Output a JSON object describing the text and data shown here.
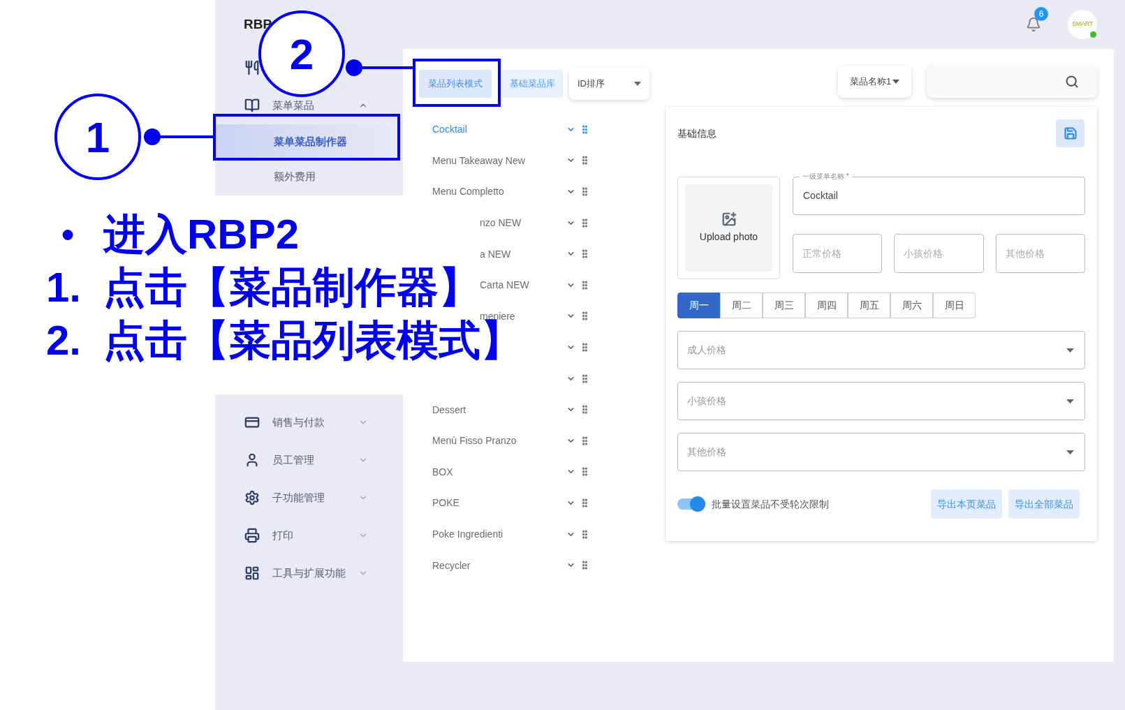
{
  "header": {
    "title": "RBP",
    "notification_count": "6",
    "avatar_logo": "SMART",
    "online": true
  },
  "sidebar": [
    {
      "kind": "icon_only"
    },
    {
      "kind": "group",
      "label": "菜单菜品",
      "expanded": true,
      "children": [
        {
          "label": "菜单菜品制作器",
          "selected": true
        },
        {
          "label": "额外费用",
          "selected": false
        }
      ]
    },
    {
      "kind": "group",
      "label": "销售与付款",
      "expanded": false
    },
    {
      "kind": "group",
      "label": "员工管理",
      "expanded": false
    },
    {
      "kind": "group",
      "label": "子功能管理",
      "expanded": false
    },
    {
      "kind": "group",
      "label": "打印",
      "expanded": false
    },
    {
      "kind": "group",
      "label": "工具与扩展功能",
      "expanded": false
    }
  ],
  "menu_list": {
    "tabs": [
      {
        "label": "菜品列表模式",
        "selected": true
      },
      {
        "label": "基础菜品库",
        "selected": false
      }
    ],
    "sort": "ID排序",
    "items": [
      {
        "kind": "full",
        "label": "Cocktail",
        "selected": true
      },
      {
        "kind": "full",
        "label": "Menu Takeaway New",
        "selected": false
      },
      {
        "kind": "full",
        "label": "Menu Completto",
        "selected": false
      },
      {
        "kind": "clipped",
        "label": "nzo NEW",
        "selected": false
      },
      {
        "kind": "clipped",
        "label": "a NEW",
        "selected": false
      },
      {
        "kind": "clipped",
        "label": "Carta NEW",
        "selected": false
      },
      {
        "kind": "clipped",
        "label": "meniere",
        "selected": false
      },
      {
        "kind": "hidden",
        "selected": false
      },
      {
        "kind": "hidden",
        "selected": false
      },
      {
        "kind": "full",
        "label": "Dessert",
        "selected": false
      },
      {
        "kind": "full",
        "label": "Menù Fisso Pranzo",
        "selected": false
      },
      {
        "kind": "full",
        "label": "BOX",
        "selected": false
      },
      {
        "kind": "full",
        "label": "POKE",
        "selected": false
      },
      {
        "kind": "full",
        "label": "Poke Ingredienti",
        "selected": false
      },
      {
        "kind": "full",
        "label": "Recycler",
        "selected": false
      }
    ]
  },
  "search": {
    "filter": "菜品名称1"
  },
  "form": {
    "title": "基础信息",
    "upload_label": "Upload photo",
    "name_field": {
      "label": "一级菜单名称 *",
      "value": "Cocktail"
    },
    "price_fields": [
      {
        "placeholder": "正常价格"
      },
      {
        "placeholder": "小孩价格"
      },
      {
        "placeholder": "其他价格"
      }
    ],
    "days": [
      {
        "label": "周一",
        "selected": true
      },
      {
        "label": "周二",
        "selected": false
      },
      {
        "label": "周三",
        "selected": false
      },
      {
        "label": "周四",
        "selected": false
      },
      {
        "label": "周五",
        "selected": false
      },
      {
        "label": "周六",
        "selected": false
      },
      {
        "label": "周日",
        "selected": false
      }
    ],
    "price_selects": [
      {
        "placeholder": "成人价格"
      },
      {
        "placeholder": "小孩价格"
      },
      {
        "placeholder": "其他价格"
      }
    ],
    "toggle": {
      "label": "批量设置菜品不受轮次限制",
      "on": true
    },
    "buttons": [
      "导出本页菜品",
      "导出全部菜品"
    ]
  },
  "annotation": {
    "markers": [
      {
        "number": "1"
      },
      {
        "number": "2"
      }
    ],
    "instructions": [
      {
        "kind": "bullet",
        "marker": "•",
        "text": "进入RBP2"
      },
      {
        "kind": "numbered",
        "marker": "1.",
        "text": "点击【菜品制作器】"
      },
      {
        "kind": "numbered",
        "marker": "2.",
        "text": "点击【菜品列表模式】"
      }
    ]
  }
}
